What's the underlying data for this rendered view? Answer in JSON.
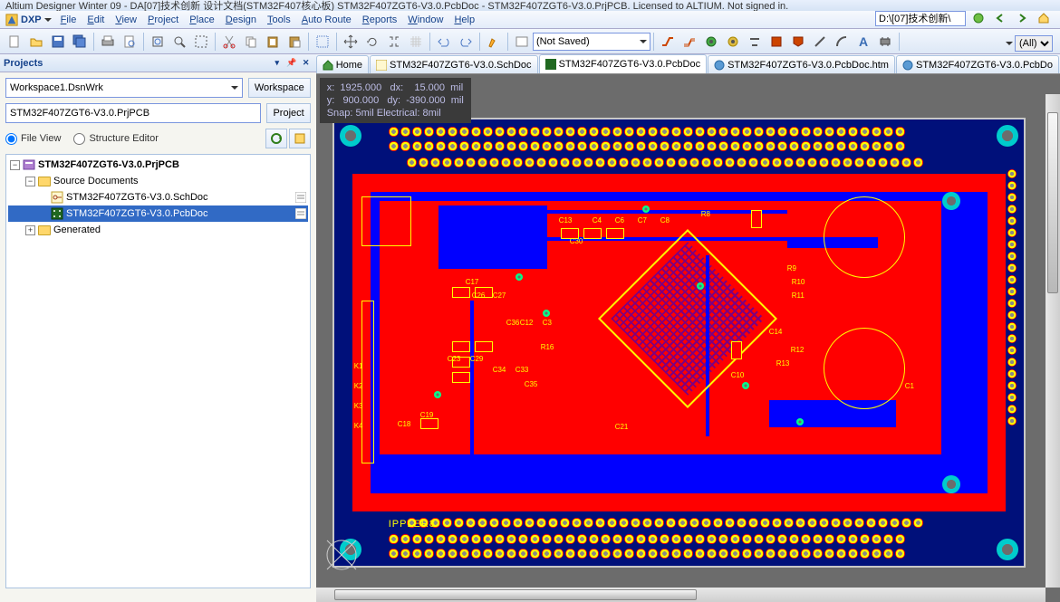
{
  "titlebar": "Altium Designer Winter 09 - DA[07]技术创新 设计文档(STM32F407核心板) STM32F407ZGT6-V3.0.PcbDoc - STM32F407ZGT6-V3.0.PrjPCB. Licensed to ALTIUM. Not signed in.",
  "path_input": "D:\\[07]技术创新\\",
  "menus": [
    "DXP",
    "File",
    "Edit",
    "View",
    "Project",
    "Place",
    "Design",
    "Tools",
    "Auto Route",
    "Reports",
    "Window",
    "Help"
  ],
  "toolbar_select": "(Not Saved)",
  "filter_select": "(All)",
  "panel": {
    "title": "Projects",
    "workspace": "Workspace1.DsnWrk",
    "workspace_btn": "Workspace",
    "project": "STM32F407ZGT6-V3.0.PrjPCB",
    "project_btn": "Project",
    "radio_file": "File View",
    "radio_struct": "Structure Editor"
  },
  "tree": {
    "root": "STM32F407ZGT6-V3.0.PrjPCB",
    "source_docs": "Source Documents",
    "sch": "STM32F407ZGT6-V3.0.SchDoc",
    "pcb": "STM32F407ZGT6-V3.0.PcbDoc",
    "generated": "Generated"
  },
  "tabs": {
    "home": "Home",
    "sch": "STM32F407ZGT6-V3.0.SchDoc",
    "pcb": "STM32F407ZGT6-V3.0.PcbDoc",
    "htm": "STM32F407ZGT6-V3.0.PcbDoc.htm",
    "pcb2": "STM32F407ZGT6-V3.0.PcbDo"
  },
  "status": {
    "x_label": "x:",
    "x_val": "1925.000",
    "dx_label": "dx:",
    "dx_val": "15.000",
    "unit": "mil",
    "y_label": "y:",
    "y_val": "900.000",
    "dy_label": "dy:",
    "dy_val": "-390.000",
    "snap": "Snap: 5mil Electrical: 8mil"
  },
  "board_text": {
    "ippler": "IPPLER8"
  },
  "designators": [
    "C13",
    "C30",
    "C4",
    "C6",
    "C7",
    "C8",
    "R8",
    "R9",
    "R10",
    "R11",
    "C17",
    "C26",
    "C27",
    "C12",
    "C3",
    "C14",
    "R12",
    "C23",
    "C29",
    "C34",
    "C33",
    "C36",
    "C35",
    "R16",
    "C21",
    "C10",
    "C19",
    "C18",
    "C1",
    "K1",
    "K2",
    "K3",
    "K4",
    "R13"
  ],
  "colors": {
    "copper": "#ff0000",
    "silk": "#ffff00",
    "inner": "#0000ff",
    "drill": "#6c6c6c",
    "teal": "#00b7b7",
    "board_bg": "#00107a",
    "workspace": "#6c6c6c"
  }
}
